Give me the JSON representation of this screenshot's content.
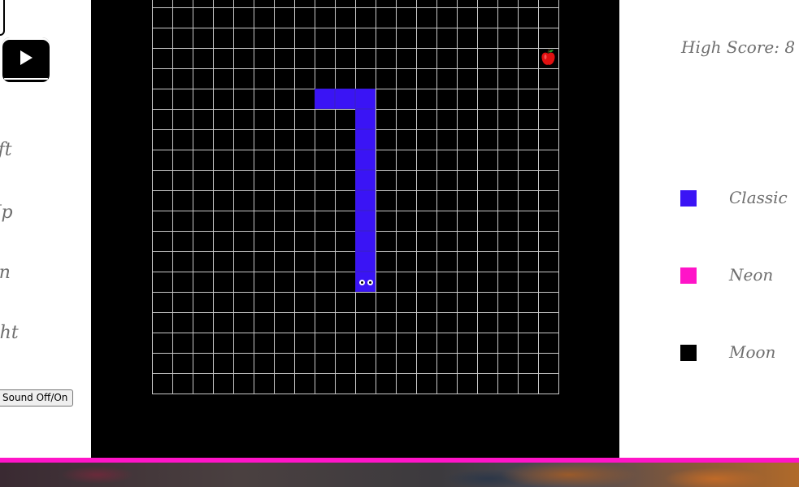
{
  "controls": {
    "left_label": "Left",
    "up_label": "Up",
    "down_label": "Down",
    "right_label": "Right",
    "sound_button_label": "Sound Off/On"
  },
  "score": {
    "high_score_text": "High Score: 8"
  },
  "themes": [
    {
      "label": "Classic",
      "color": "#3a14f5"
    },
    {
      "label": "Neon",
      "color": "#ff14c8"
    },
    {
      "label": "Moon",
      "color": "#000000"
    }
  ],
  "board": {
    "columns": 20,
    "rows": 20,
    "snake_color": "#3a14f5",
    "snake": [
      [
        8,
        5
      ],
      [
        9,
        5
      ],
      [
        10,
        5
      ],
      [
        10,
        6
      ],
      [
        10,
        7
      ],
      [
        10,
        8
      ],
      [
        10,
        9
      ],
      [
        10,
        10
      ],
      [
        10,
        11
      ],
      [
        10,
        12
      ],
      [
        10,
        13
      ],
      [
        10,
        14
      ]
    ],
    "apple": [
      19,
      3
    ]
  },
  "colors": {
    "accent_bar": "#ff14c8",
    "game_background": "#000000",
    "text": "#6e6e6e"
  },
  "icons": {
    "play": "play-icon",
    "apple": "apple-icon",
    "eyes": "snake-eyes"
  }
}
